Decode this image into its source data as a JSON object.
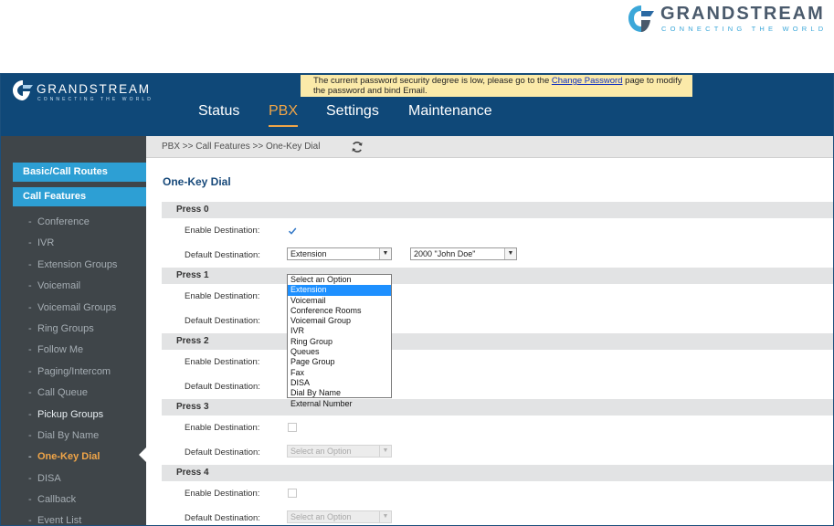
{
  "top_logo": {
    "word": "GRANDSTREAM",
    "tagline": "CONNECTING THE WORLD"
  },
  "app_logo": {
    "word": "GRANDSTREAM",
    "tagline": "CONNECTING THE WORLD"
  },
  "notice": {
    "before": "The current password security degree is low, please go to the ",
    "link": "Change Password",
    "after": " page to modify the password and bind Email."
  },
  "nav": {
    "items": [
      "Status",
      "PBX",
      "Settings",
      "Maintenance"
    ],
    "active": "PBX"
  },
  "sidebar": {
    "headers": [
      "Basic/Call Routes",
      "Call Features"
    ],
    "items": [
      "Conference",
      "IVR",
      "Extension Groups",
      "Voicemail",
      "Voicemail Groups",
      "Ring Groups",
      "Follow Me",
      "Paging/Intercom",
      "Call Queue",
      "Pickup Groups",
      "Dial By Name",
      "One-Key Dial",
      "DISA",
      "Callback",
      "Event List"
    ],
    "selected": "One-Key Dial"
  },
  "breadcrumb": "PBX >> Call Features >> One-Key Dial",
  "page_title": "One-Key Dial",
  "labels": {
    "enable_destination": "Enable Destination:",
    "default_destination": "Default Destination:"
  },
  "sections": [
    {
      "title": "Press 0",
      "enabled": true,
      "destination_type": "Extension",
      "destination_value": "2000 \"John Doe\""
    },
    {
      "title": "Press 1"
    },
    {
      "title": "Press 2"
    },
    {
      "title": "Press 3",
      "enabled": false,
      "placeholder": "Select an Option"
    },
    {
      "title": "Press 4",
      "enabled": false,
      "placeholder": "Select an Option"
    }
  ],
  "dropdown": {
    "options": [
      "Select an Option",
      "Extension",
      "Voicemail",
      "Conference Rooms",
      "Voicemail Group",
      "IVR",
      "Ring Group",
      "Queues",
      "Page Group",
      "Fax",
      "DISA",
      "Dial By Name",
      "External Number"
    ],
    "highlighted": "Extension"
  },
  "colors": {
    "header_bg": "#0f4878",
    "sidebar_bg": "#3f4549",
    "accent_blue": "#2d9fd4",
    "accent_orange": "#f0a548",
    "notice_bg": "#fbeaa9"
  }
}
